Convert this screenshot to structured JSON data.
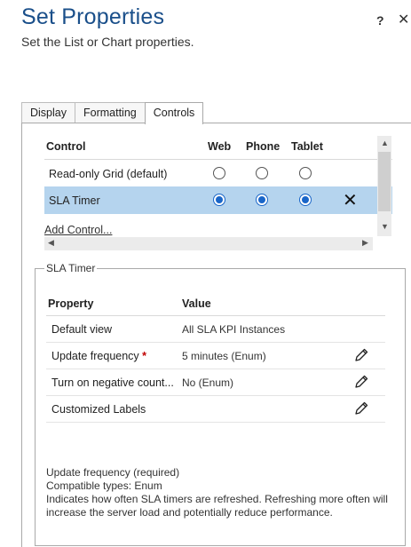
{
  "dialog": {
    "title": "Set Properties",
    "subtitle": "Set the List or Chart properties.",
    "help_glyph": "?",
    "close_glyph": "✕"
  },
  "tabs": [
    {
      "label": "Display",
      "active": false
    },
    {
      "label": "Formatting",
      "active": false
    },
    {
      "label": "Controls",
      "active": true
    }
  ],
  "controls_grid": {
    "headers": {
      "control": "Control",
      "web": "Web",
      "phone": "Phone",
      "tablet": "Tablet"
    },
    "rows": [
      {
        "name": "Read-only Grid (default)",
        "web": false,
        "phone": false,
        "tablet": false,
        "selected": false
      },
      {
        "name": "SLA Timer",
        "web": true,
        "phone": true,
        "tablet": true,
        "selected": true,
        "remove_glyph": "✕"
      }
    ],
    "add_control_label": "Add Control...",
    "selection_color": "#b5d4ee",
    "radio_color": "#1a66c8"
  },
  "sla_timer": {
    "legend": "SLA Timer",
    "headers": {
      "property": "Property",
      "value": "Value"
    },
    "rows": [
      {
        "property": "Default view",
        "value": "All SLA KPI Instances",
        "required": false,
        "editable": false
      },
      {
        "property": "Update frequency",
        "value": "5 minutes (Enum)",
        "required": true,
        "editable": true
      },
      {
        "property": "Turn on negative count...",
        "value": "No (Enum)",
        "required": false,
        "editable": true
      },
      {
        "property": "Customized Labels",
        "value": "",
        "required": false,
        "editable": true
      }
    ],
    "required_marker": "*",
    "description": {
      "line1": "Update frequency (required)",
      "line2": "Compatible types: Enum",
      "line3": "Indicates how often SLA timers are refreshed. Refreshing more often will increase the server load and potentially reduce performance."
    }
  },
  "scroll_glyphs": {
    "up": "▲",
    "down": "▼",
    "left": "◀",
    "right": "▶"
  }
}
